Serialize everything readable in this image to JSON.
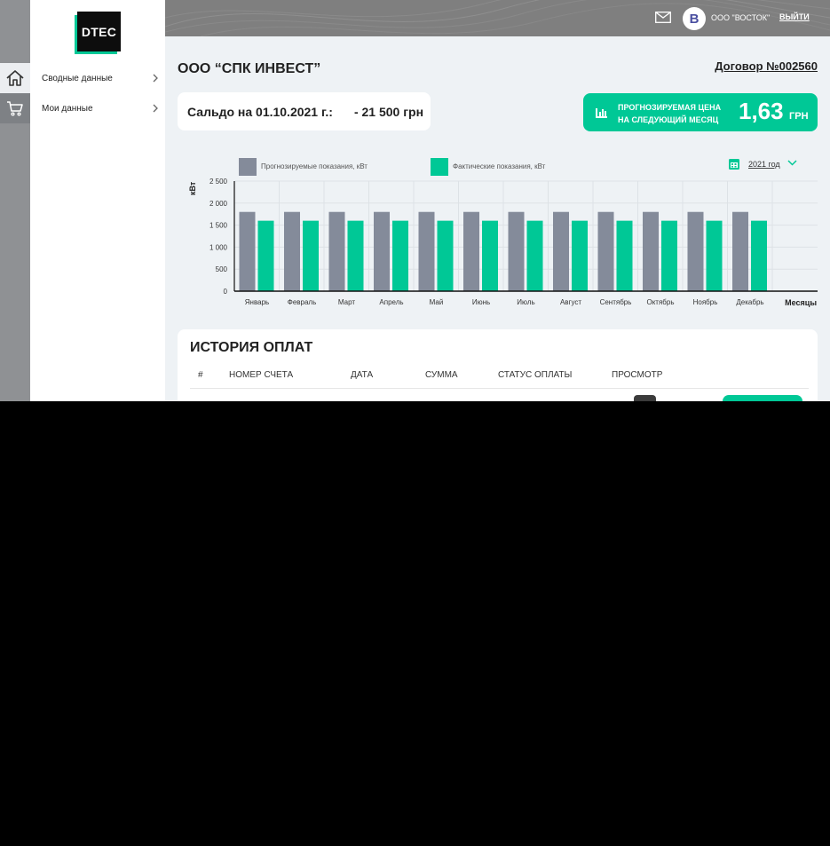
{
  "app": {
    "logo": "DTEC",
    "accent": "#00c896",
    "grey": "#848b9a"
  },
  "sidebar": {
    "items": [
      {
        "label": "Сводные данные",
        "icon": "home-icon"
      },
      {
        "label": "Мои данные",
        "icon": "cart-icon"
      }
    ]
  },
  "topbar": {
    "avatar_letter": "В",
    "company": "ООО \"ВОСТОК\"",
    "logout": "ВЫЙТИ"
  },
  "header": {
    "title": "ООО “СПК ИНВЕСТ”",
    "contract": "Договор №002560"
  },
  "balance": {
    "label": "Сальдо на 01.10.2021 г.:",
    "amount": "- 21 500 грн"
  },
  "forecast": {
    "line1": "ПРОГНОЗИРУЕМАЯ ЦЕНА",
    "line2": "НА СЛЕДУЮЩИЙ МЕСЯЦ",
    "value": "1,63",
    "unit": "ГРН"
  },
  "year_selector": "2021 год",
  "chart_data": {
    "type": "bar",
    "categories": [
      "Январь",
      "Февраль",
      "Март",
      "Апрель",
      "Май",
      "Июнь",
      "Июль",
      "Август",
      "Сентябрь",
      "Октябрь",
      "Ноябрь",
      "Декабрь"
    ],
    "series": [
      {
        "name": "Прогнозируемые показания, кВт",
        "values": [
          1800,
          1800,
          1800,
          1800,
          1800,
          1800,
          1800,
          1800,
          1800,
          1800,
          1800,
          1800
        ],
        "color": "#848b9a"
      },
      {
        "name": "Фактические показания, кВт",
        "values": [
          1600,
          1600,
          1600,
          1600,
          1600,
          1600,
          1600,
          1600,
          1600,
          1600,
          1600,
          1600
        ],
        "color": "#00c896"
      }
    ],
    "yticks": [
      "0",
      "500",
      "1 000",
      "1 500",
      "2 000",
      "2 500"
    ],
    "ylim": [
      0,
      2500
    ],
    "ylabel": "кВт",
    "xlabel": "Месяцы",
    "grid": true,
    "legend": "top-left"
  },
  "history": {
    "title": "ИСТОРИЯ ОПЛАТ",
    "columns": [
      "#",
      "НОМЕР СЧЕТА",
      "ДАТА",
      "СУММА",
      "СТАТУС ОПЛАТЫ",
      "ПРОСМОТР"
    ]
  }
}
